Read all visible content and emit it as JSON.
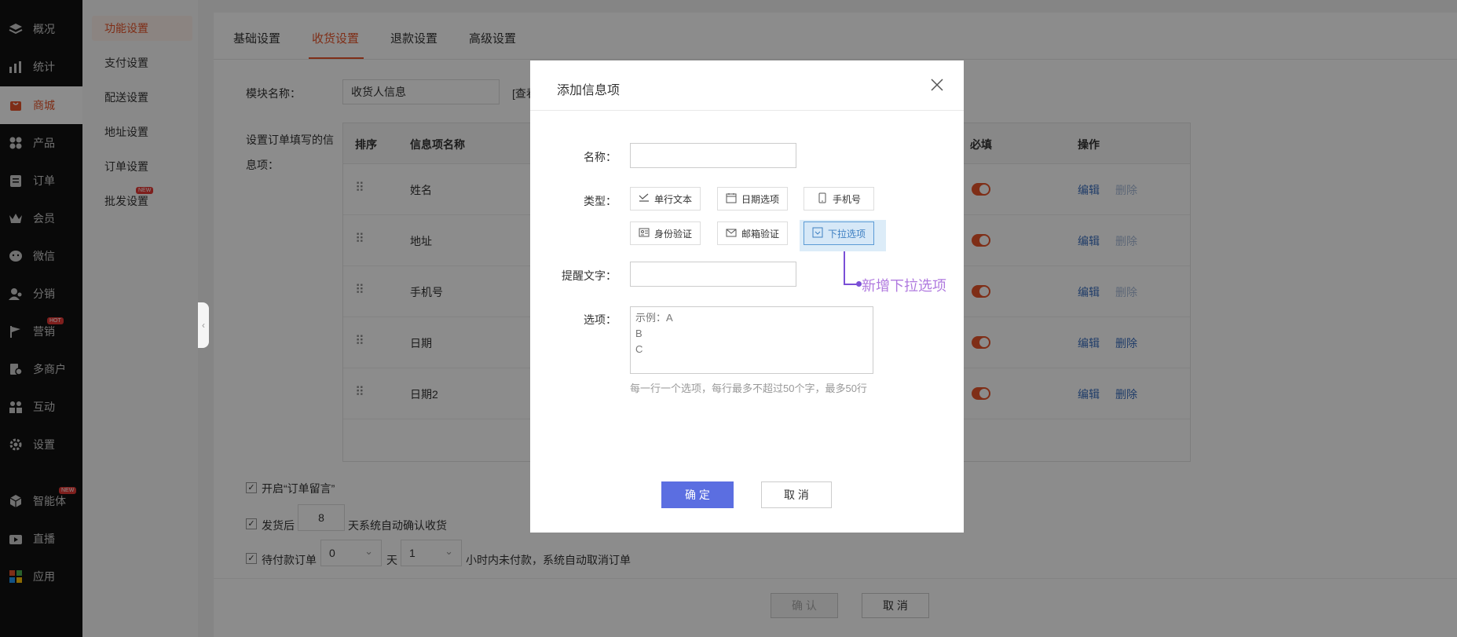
{
  "nav": {
    "items": [
      {
        "label": "概况",
        "icon": "layers-icon"
      },
      {
        "label": "统计",
        "icon": "chart-icon"
      },
      {
        "label": "商城",
        "icon": "shop-icon"
      },
      {
        "label": "产品",
        "icon": "grid-icon"
      },
      {
        "label": "订单",
        "icon": "order-icon"
      },
      {
        "label": "会员",
        "icon": "crown-icon"
      },
      {
        "label": "微信",
        "icon": "wechat-icon"
      },
      {
        "label": "分销",
        "icon": "users-icon"
      },
      {
        "label": "营销",
        "icon": "flag-icon",
        "badge": "HOT"
      },
      {
        "label": "多商户",
        "icon": "store-icon"
      },
      {
        "label": "互动",
        "icon": "interact-icon"
      },
      {
        "label": "设置",
        "icon": "gear-icon"
      },
      {
        "label": "智能体",
        "icon": "cube-icon",
        "badge": "NEW"
      },
      {
        "label": "直播",
        "icon": "video-icon"
      },
      {
        "label": "应用",
        "icon": "apps-icon"
      }
    ],
    "active_index": 2
  },
  "subnav": {
    "items": [
      "功能设置",
      "支付设置",
      "配送设置",
      "地址设置",
      "订单设置",
      "批发设置"
    ],
    "active_index": 0,
    "badge": "NEW"
  },
  "tabs": [
    "基础设置",
    "收货设置",
    "退款设置",
    "高级设置"
  ],
  "module": {
    "label": "模块名称：",
    "value": "收货人信息",
    "extra": "[查看"
  },
  "info_label": "设置订单填写的信息项：",
  "table": {
    "headers": {
      "sort": "排序",
      "name": "信息项名称",
      "required": "必填",
      "ops": "操作"
    },
    "rows": [
      {
        "name": "姓名",
        "edit": "编辑",
        "delete": "删除",
        "delete_enabled": false
      },
      {
        "name": "地址",
        "edit": "编辑",
        "delete": "删除",
        "delete_enabled": false
      },
      {
        "name": "手机号",
        "edit": "编辑",
        "delete": "删除",
        "delete_enabled": false
      },
      {
        "name": "日期",
        "edit": "编辑",
        "delete": "删除",
        "delete_enabled": true
      },
      {
        "name": "日期2",
        "edit": "编辑",
        "delete": "删除",
        "delete_enabled": true
      }
    ]
  },
  "options": {
    "note_label": "开启“订单留言”",
    "ship_prefix": "发货后",
    "ship_days": "8",
    "ship_suffix": "天系统自动确认收货",
    "unpaid_prefix": "待付款订单",
    "unpaid_days": "0",
    "day_unit": "天",
    "unpaid_hours": "1",
    "unpaid_suffix": "小时内未付款，系统自动取消订单"
  },
  "footer": {
    "confirm": "确 认",
    "cancel": "取 消"
  },
  "modal": {
    "title": "添加信息项",
    "name_label": "名称：",
    "type_label": "类型：",
    "types": [
      {
        "label": "单行文本",
        "icon": "text-line-icon"
      },
      {
        "label": "日期选项",
        "icon": "calendar-icon"
      },
      {
        "label": "手机号",
        "icon": "phone-icon"
      },
      {
        "label": "身份验证",
        "icon": "id-card-icon"
      },
      {
        "label": "邮箱验证",
        "icon": "mail-icon"
      },
      {
        "label": "下拉选项",
        "icon": "dropdown-icon"
      }
    ],
    "selected_type": "下拉选项",
    "tip_label": "提醒文字：",
    "options_label": "选项：",
    "options_placeholder": "示例：A\nB\nC",
    "options_hint": "每一行一个选项，每行最多不超过50个字，最多50行",
    "ok": "确 定",
    "cancel": "取 消"
  },
  "annotation": "新增下拉选项",
  "colors": {
    "accent": "#e8552b",
    "primary": "#5b6ee1",
    "link": "#3b6fc0",
    "annotation": "#b07adf"
  }
}
